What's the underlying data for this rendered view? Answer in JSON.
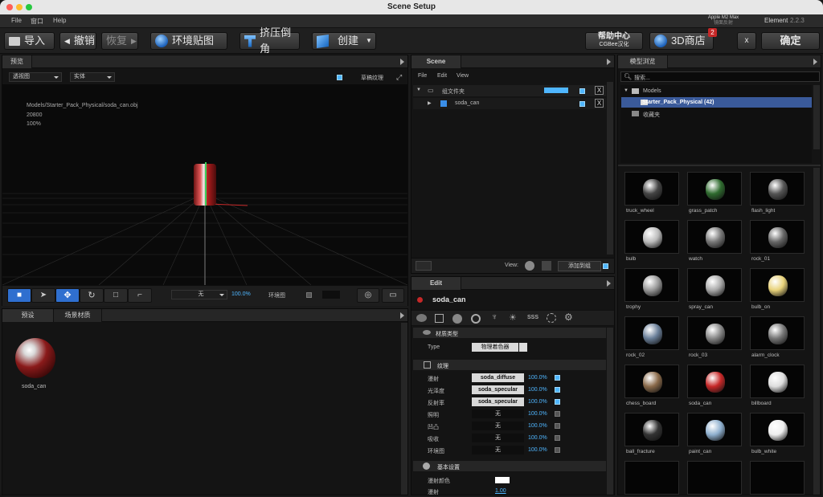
{
  "window": {
    "title": "Scene Setup"
  },
  "menu": {
    "items": [
      "File",
      "窗口",
      "Help"
    ],
    "chip": "Apple M2 Max",
    "chip_sub": "镜面反射",
    "app": "Element",
    "version": "2.2.3"
  },
  "toolbar": {
    "import": "导入",
    "undo": "撤销",
    "redo": "恢复",
    "env_map": "环境贴图",
    "extrude": "挤压倒角",
    "create": "创建",
    "help_center": "帮助中心",
    "help_sub": "CGBee汉化",
    "store": "3D商店",
    "store_badge": "2",
    "close": "x",
    "confirm": "确定"
  },
  "preview": {
    "tab": "预览",
    "view_mode": "透视图",
    "shade_mode": "实体",
    "draft_texture": "草稿纹理",
    "info_path": "Models/Starter_Pack_Physical/soda_can.obj",
    "info_faces": "20800",
    "info_pct": "100%",
    "bottom_select": "无",
    "bottom_value": "100.0%",
    "env_label": "环境图"
  },
  "scene": {
    "title": "Scene",
    "menu": [
      "File",
      "Edit",
      "View"
    ],
    "group_folder": "组文件夹",
    "item": "soda_can",
    "view_label": "View:",
    "add_to_group": "添加到组"
  },
  "presets": {
    "tabs": [
      "预设",
      "场景材质"
    ],
    "material_name": "soda_can"
  },
  "edit": {
    "title": "Edit",
    "object": "soda_can",
    "material_type_header": "材质类型",
    "type_label": "Type",
    "type_value": "物理着色器",
    "texture_header": "纹理",
    "texture_rows": [
      {
        "label": "漫射",
        "value": "soda_diffuse",
        "pct": "100.0%",
        "on": true
      },
      {
        "label": "光泽度",
        "value": "soda_specular",
        "pct": "100.0%",
        "on": true
      },
      {
        "label": "反射率",
        "value": "soda_specular",
        "pct": "100.0%",
        "on": true
      },
      {
        "label": "照明",
        "value": "无",
        "pct": "100.0%",
        "on": false
      },
      {
        "label": "凹凸",
        "value": "无",
        "pct": "100.0%",
        "on": false
      },
      {
        "label": "吸收",
        "value": "无",
        "pct": "100.0%",
        "on": false
      },
      {
        "label": "环境图",
        "value": "无",
        "pct": "100.0%",
        "on": false
      }
    ],
    "basic_header": "基本设置",
    "diffuse_color": "漫射颜色",
    "diffuse_label": "漫射",
    "diffuse_value": "1.00"
  },
  "browser": {
    "title": "模型浏览",
    "search_placeholder": "搜索...",
    "tree": [
      "Models",
      "Starter_Pack_Physical (42)",
      "收藏夹"
    ],
    "models": [
      "truck_wheel",
      "grass_patch",
      "flash_light",
      "bulb",
      "watch",
      "rock_01",
      "trophy",
      "spray_can",
      "bulb_on",
      "rock_02",
      "rock_03",
      "alarm_clock",
      "chess_board",
      "soda_can",
      "billboard",
      "ball_fracture",
      "paint_can",
      "bulb_white"
    ]
  },
  "colors": {
    "accent": "#4fb6ff",
    "selection": "#3a5a9a",
    "bg": "#141414"
  }
}
